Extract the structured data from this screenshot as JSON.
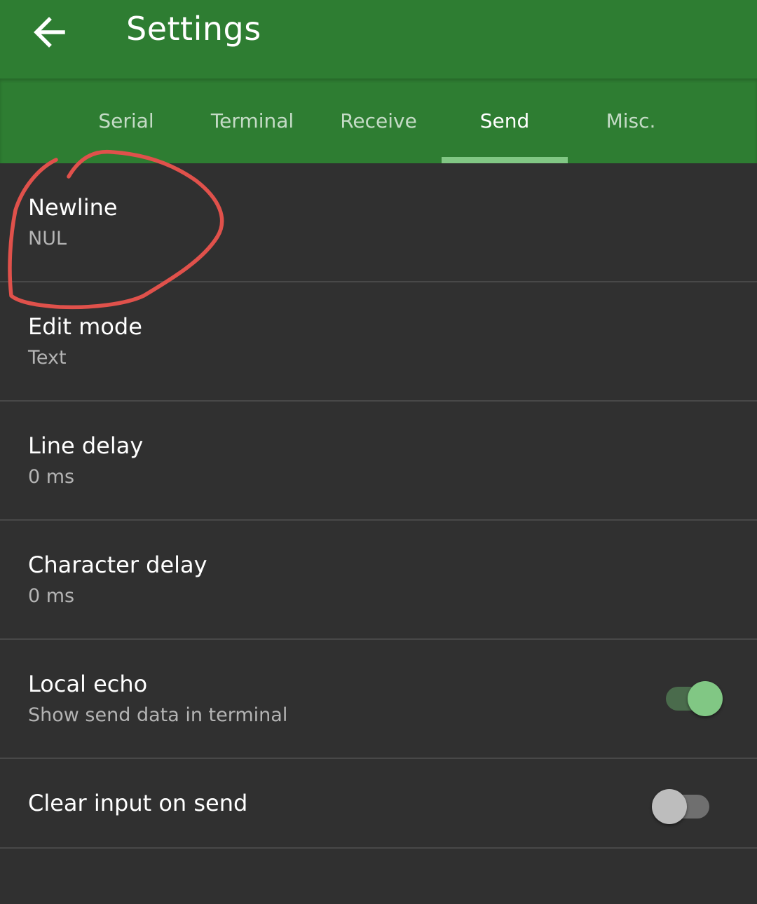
{
  "toolbar": {
    "title": "Settings",
    "back_icon": "arrow-back-icon"
  },
  "tabs": [
    {
      "label": "Serial",
      "active": false
    },
    {
      "label": "Terminal",
      "active": false
    },
    {
      "label": "Receive",
      "active": false
    },
    {
      "label": "Send",
      "active": true
    },
    {
      "label": "Misc.",
      "active": false
    }
  ],
  "preferences": [
    {
      "title": "Newline",
      "summary": "NUL"
    },
    {
      "title": "Edit mode",
      "summary": "Text"
    },
    {
      "title": "Line delay",
      "summary": "0 ms"
    },
    {
      "title": "Character delay",
      "summary": "0 ms"
    },
    {
      "title": "Local echo",
      "summary": "Show send data in terminal",
      "switch": true
    },
    {
      "title": "Clear input on send",
      "switch": false
    }
  ],
  "annotation": {
    "shape": "freehand-circle",
    "target": "Newline",
    "color": "#e0514b"
  },
  "colors": {
    "primary": "#2e7d32",
    "accent": "#81c784",
    "background": "#303030",
    "divider": "#484848"
  }
}
